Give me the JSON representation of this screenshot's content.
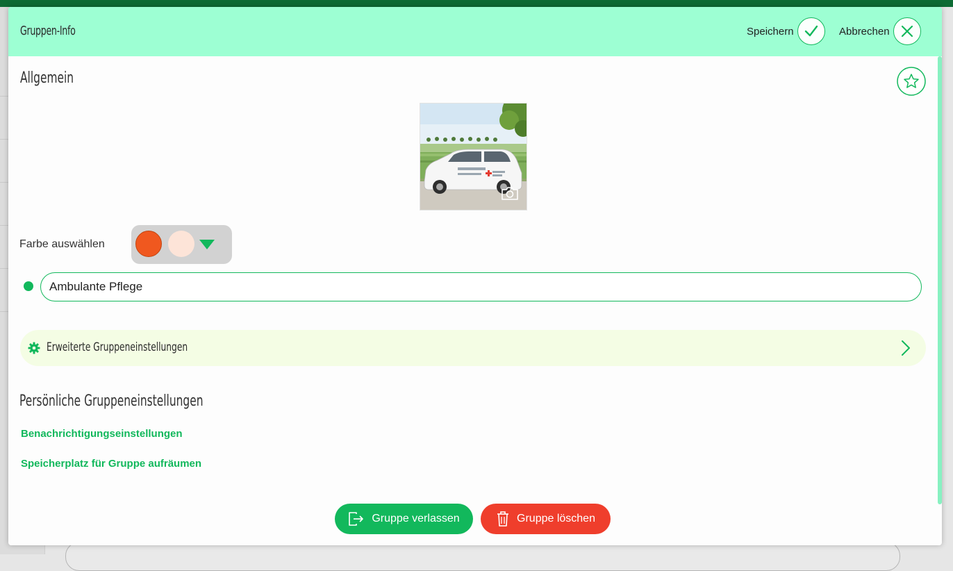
{
  "header": {
    "title": "Gruppen-Info",
    "save_label": "Speichern",
    "cancel_label": "Abbrechen"
  },
  "general": {
    "title": "Allgemein",
    "color_label": "Farbe auswählen",
    "colors": {
      "primary": "#f0581f",
      "secondary": "#fde4d8"
    },
    "group_name": "Ambulante Pflege",
    "advanced_settings_label": "Erweiterte Gruppeneinstellungen"
  },
  "personal": {
    "title": "Persönliche Gruppeneinstellungen",
    "links": [
      "Benachrichtigungseinstellungen",
      "Speicherplatz für Gruppe aufräumen"
    ]
  },
  "footer": {
    "leave_label": "Gruppe verlassen",
    "delete_label": "Gruppe löschen"
  },
  "theme": {
    "accent": "#12b85c",
    "header_bg": "#9dffd3",
    "danger": "#ef3e2c"
  },
  "icons": [
    "check-icon",
    "close-icon",
    "star-icon",
    "camera-icon",
    "gear-icon",
    "chevron-right-icon",
    "caret-down-icon",
    "leave-icon",
    "trash-icon"
  ]
}
